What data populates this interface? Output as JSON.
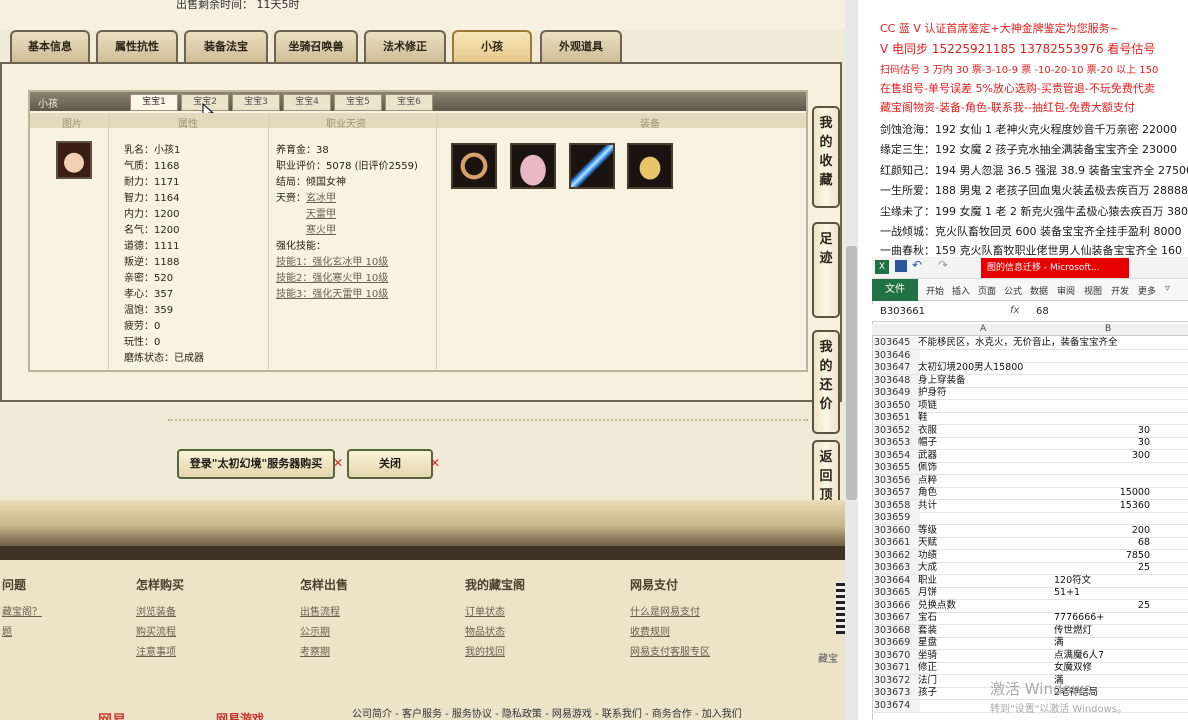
{
  "game_page": {
    "sale_remaining": "出售剩余时间： 11天5时",
    "tabs": [
      "基本信息",
      "属性抗性",
      "装备法宝",
      "坐骑召唤兽",
      "法术修正",
      "小孩",
      "外观道具"
    ],
    "active_tab": "小孩",
    "panel_title": "小孩",
    "baby_tabs": [
      "宝宝1",
      "宝宝2",
      "宝宝3",
      "宝宝4",
      "宝宝5",
      "宝宝6"
    ],
    "columns": [
      "图片",
      "属性",
      "职业天资",
      "装备"
    ],
    "attributes": [
      "乳名：小孩1",
      "气质：1168",
      "耐力：1171",
      "智力：1164",
      "内力：1200",
      "名气：1200",
      "道德：1111",
      "叛逆：1188",
      "亲密：520",
      "孝心：357",
      "温饱：359",
      "疲劳：0",
      "玩性：0",
      "磨炼状态：已成器"
    ],
    "career": {
      "fund": "养育金：38",
      "eval": "职业评价：5078 (旧评价2559)",
      "ending": "结局：倾国女神",
      "talent_label": "天赍：",
      "talents": [
        "玄冰甲",
        "天雷甲",
        "寒火甲"
      ],
      "strengthen_label": "强化技能：",
      "skills": [
        "技能1：强化玄冰甲 10级",
        "技能2：强化寒火甲 10级",
        "技能3：强化天雷甲 10级"
      ]
    },
    "buy_button": "登录\"太初幻境\"服务器购买",
    "close_button": "关闭",
    "side_buttons": [
      "我的收藏",
      "足迹",
      "我的还价",
      "返回顶部"
    ],
    "footer": {
      "columns": [
        {
          "head": "问题",
          "links": [
            "藏宝阁？",
            "题"
          ]
        },
        {
          "head": "怎样购买",
          "links": [
            "浏览装备",
            "购买流程",
            "注意事项"
          ]
        },
        {
          "head": "怎样出售",
          "links": [
            "出售流程",
            "公示期",
            "考察期"
          ]
        },
        {
          "head": "我的藏宝阁",
          "links": [
            "订单状态",
            "物品状态",
            "我的找回"
          ]
        },
        {
          "head": "网易支付",
          "links": [
            "什么是网易支付",
            "收费规则",
            "网易支付客服专区"
          ]
        }
      ],
      "bottom_links": "公司简介 - 客户服务 - 服务协议 - 隐私政策 - 网易游戏 - 联系我们 - 商务合作 - 加入我们",
      "logo1": "网易",
      "logo2": "网易游戏",
      "side_text": "藏宝"
    }
  },
  "ad_panel": {
    "lines": [
      {
        "text": "CC 蓝 V 认证首席鉴定+大神金牌鉴定为您服务~",
        "color": "#e02020"
      },
      {
        "text": "V 电同步 15225921185 13782553976 看号估号",
        "color": "#e02020"
      },
      {
        "text": "扫码估号 3 万内 30 票-3-10-9 票 -10-20-10 票-20 以上 150",
        "color": "#e02020"
      },
      {
        "text": "在售组号-单号误差 5%放心选购-买贵管退-不玩免费代卖",
        "color": "#e02020"
      },
      {
        "text": "藏宝阁物资-装备-角色-联系我--抽红包-免费大额支付",
        "color": "#e02020"
      },
      {
        "text": "剑蚀沧海：192 女仙 1 老神火克火程度妙音千万亲密 22000",
        "color": "#1a1a1a"
      },
      {
        "text": "缘定三生：192 女魔 2 孩子克水抽全满装备宝宝齐全 23000",
        "color": "#1a1a1a"
      },
      {
        "text": "红颜知己：194 男人忽混 36.5 强混 38.9 装备宝宝齐全 27500",
        "color": "#1a1a1a"
      },
      {
        "text": "一生所爱：188 男鬼 2 老孩子回血鬼火装孟极去疾百万 28888",
        "color": "#1a1a1a"
      },
      {
        "text": "尘缘未了：199 女魔 1 老 2 新克火强牛孟极心猿去疾百万 380",
        "color": "#1a1a1a"
      },
      {
        "text": "一战倾城：克火队畜牧回灵 600 装备宝宝齐全挂手盈利 8000",
        "color": "#1a1a1a"
      },
      {
        "text": "一曲春秋：159 克火队畜牧职业佬世男人仙装备宝宝齐全 160",
        "color": "#1a1a1a"
      }
    ]
  },
  "excel": {
    "title": "图的信息迁移 - Microsoft...",
    "file_tab": "文件",
    "ribbon_tabs": [
      "开始",
      "插入",
      "页面",
      "公式",
      "数据",
      "审阅",
      "视图",
      "开发",
      "更多"
    ],
    "name_box": "B303661",
    "fx": "fx",
    "formula_value": "68",
    "col_a": "A",
    "col_b": "B",
    "rows": [
      {
        "n": "303645",
        "a": "不能移民区，水克火，无价音止，装备宝宝齐全",
        "b": "",
        "bl": ""
      },
      {
        "n": "303646",
        "a": "",
        "b": "",
        "bl": ""
      },
      {
        "n": "303647",
        "a": "太初幻境200男人15800",
        "b": "",
        "bl": ""
      },
      {
        "n": "303648",
        "a": "身上穿装备",
        "b": "",
        "bl": ""
      },
      {
        "n": "303649",
        "a": "护身符",
        "b": "",
        "bl": ""
      },
      {
        "n": "303650",
        "a": "项链",
        "b": "",
        "bl": ""
      },
      {
        "n": "303651",
        "a": "鞋",
        "b": "",
        "bl": ""
      },
      {
        "n": "303652",
        "a": "衣服",
        "b": "30",
        "bl": ""
      },
      {
        "n": "303653",
        "a": "帽子",
        "b": "30",
        "bl": ""
      },
      {
        "n": "303654",
        "a": "武器",
        "b": "300",
        "bl": ""
      },
      {
        "n": "303655",
        "a": "佩饰",
        "b": "",
        "bl": ""
      },
      {
        "n": "303656",
        "a": "点粹",
        "b": "",
        "bl": ""
      },
      {
        "n": "303657",
        "a": "角色",
        "b": "15000",
        "bl": ""
      },
      {
        "n": "303658",
        "a": "共计",
        "b": "15360",
        "bl": ""
      },
      {
        "n": "303659",
        "a": "",
        "b": "",
        "bl": ""
      },
      {
        "n": "303660",
        "a": "等级",
        "b": "200",
        "bl": ""
      },
      {
        "n": "303661",
        "a": "天赋",
        "b": "68",
        "bl": ""
      },
      {
        "n": "303662",
        "a": "功绩",
        "b": "7850",
        "bl": ""
      },
      {
        "n": "303663",
        "a": "大成",
        "b": "25",
        "bl": ""
      },
      {
        "n": "303664",
        "a": "职业",
        "b": "",
        "bl": "120符文"
      },
      {
        "n": "303665",
        "a": "月饼",
        "b": "",
        "bl": "51+1"
      },
      {
        "n": "303666",
        "a": "兑换点数",
        "b": "25",
        "bl": ""
      },
      {
        "n": "303667",
        "a": "宝石",
        "b": "",
        "bl": "7776666+"
      },
      {
        "n": "303668",
        "a": "套装",
        "b": "",
        "bl": "传世燃灯"
      },
      {
        "n": "303669",
        "a": "星盘",
        "b": "",
        "bl": "满"
      },
      {
        "n": "303670",
        "a": "坐骑",
        "b": "",
        "bl": "点满魔6人7"
      },
      {
        "n": "303671",
        "a": "修正",
        "b": "",
        "bl": "女魔双修"
      },
      {
        "n": "303672",
        "a": "法门",
        "b": "",
        "bl": "满"
      },
      {
        "n": "303673",
        "a": "孩子",
        "b": "",
        "bl": "2老神结局"
      },
      {
        "n": "303674",
        "a": "",
        "b": "",
        "bl": ""
      }
    ]
  },
  "watermark": {
    "line1": "激活 Windows",
    "line2": "转到\"设置\"以激活 Windows。"
  }
}
